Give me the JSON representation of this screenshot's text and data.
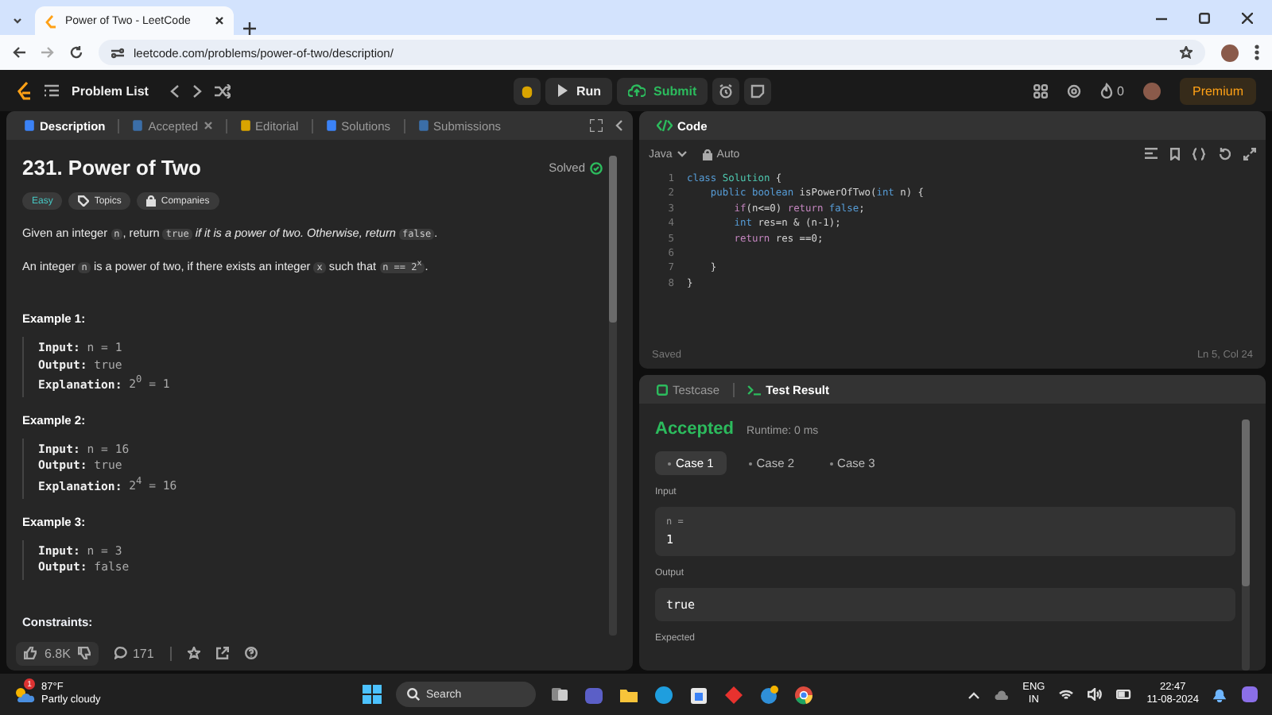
{
  "browser": {
    "tab_title": "Power of Two - LeetCode",
    "url": "leetcode.com/problems/power-of-two/description/"
  },
  "nav": {
    "problem_list": "Problem List",
    "run": "Run",
    "submit": "Submit",
    "streak": "0",
    "premium": "Premium"
  },
  "left_tabs": [
    {
      "label": "Description",
      "selected": true,
      "closable": false
    },
    {
      "label": "Accepted",
      "selected": false,
      "closable": true
    },
    {
      "label": "Editorial",
      "selected": false,
      "closable": false
    },
    {
      "label": "Solutions",
      "selected": false,
      "closable": false
    },
    {
      "label": "Submissions",
      "selected": false,
      "closable": false
    }
  ],
  "problem": {
    "title": "231. Power of Two",
    "status": "Solved",
    "difficulty": "Easy",
    "tags": [
      "Topics",
      "Companies"
    ],
    "paragraphs": [
      [
        {
          "kind": "text",
          "text": "Given an integer "
        },
        {
          "kind": "code",
          "text": "n"
        },
        {
          "kind": "text",
          "text": ", return "
        },
        {
          "kind": "code",
          "text": "true"
        },
        {
          "kind": "em",
          "text": " if it is a power of two. Otherwise, return "
        },
        {
          "kind": "code",
          "text": "false"
        },
        {
          "kind": "text",
          "text": "."
        }
      ],
      [
        {
          "kind": "text",
          "text": "An integer "
        },
        {
          "kind": "code",
          "text": "n"
        },
        {
          "kind": "text",
          "text": " is a power of two, if there exists an integer "
        },
        {
          "kind": "code",
          "text": "x"
        },
        {
          "kind": "text",
          "text": " such that "
        },
        {
          "kind": "code",
          "text": "n == 2$^{x}$"
        },
        {
          "kind": "text",
          "text": "."
        }
      ]
    ],
    "examples": [
      {
        "title": "Example 1:",
        "lines": [
          {
            "label": "Input:",
            "value": "n = 1"
          },
          {
            "label": "Output:",
            "value": "true"
          },
          {
            "label": "Explanation:",
            "value": "2$^{0}$ = 1"
          }
        ]
      },
      {
        "title": "Example 2:",
        "lines": [
          {
            "label": "Input:",
            "value": "n = 16"
          },
          {
            "label": "Output:",
            "value": "true"
          },
          {
            "label": "Explanation:",
            "value": "2$^{4}$ = 16"
          }
        ]
      },
      {
        "title": "Example 3:",
        "lines": [
          {
            "label": "Input:",
            "value": "n = 3"
          },
          {
            "label": "Output:",
            "value": "false"
          }
        ]
      }
    ],
    "constraints_heading": "Constraints:",
    "likes": "6.8K",
    "comments": "171"
  },
  "code": {
    "title": "Code",
    "language": "Java",
    "mode": "Auto",
    "status": "Saved",
    "cursor": "Ln 5, Col 24",
    "lines": [
      {
        "number": "1",
        "tokens": [
          {
            "kind": "kw",
            "text": "class"
          },
          {
            "kind": "type",
            "text": " Solution"
          },
          {
            "kind": "plain",
            "text": " {"
          }
        ]
      },
      {
        "number": "2",
        "tokens": [
          {
            "kind": "kw",
            "text": "    public boolean"
          },
          {
            "kind": "plain",
            "text": " isPowerOfTwo("
          },
          {
            "kind": "kw",
            "text": "int"
          },
          {
            "kind": "plain",
            "text": " n) {"
          }
        ]
      },
      {
        "number": "3",
        "tokens": [
          {
            "kind": "ctrl",
            "text": "        if"
          },
          {
            "kind": "plain",
            "text": "(n<=0) "
          },
          {
            "kind": "ctrl",
            "text": "return"
          },
          {
            "kind": "kw",
            "text": " false"
          },
          {
            "kind": "plain",
            "text": ";"
          }
        ]
      },
      {
        "number": "4",
        "tokens": [
          {
            "kind": "kw",
            "text": "        int"
          },
          {
            "kind": "plain",
            "text": " res=n & (n-1);"
          }
        ]
      },
      {
        "number": "5",
        "tokens": [
          {
            "kind": "ctrl",
            "text": "        return"
          },
          {
            "kind": "plain",
            "text": " res ==0;"
          }
        ]
      },
      {
        "number": "6"
      },
      {
        "number": "7",
        "tokens": [
          {
            "kind": "plain",
            "text": "    }"
          }
        ]
      },
      {
        "number": "8",
        "tokens": [
          {
            "kind": "plain",
            "text": "}"
          }
        ]
      }
    ]
  },
  "result_tabs": [
    {
      "label": "Testcase",
      "selected": false
    },
    {
      "label": "Test Result",
      "selected": true
    }
  ],
  "result": {
    "verdict": "Accepted",
    "runtime": "Runtime: 0 ms",
    "cases": [
      {
        "label": "Case 1",
        "selected": true
      },
      {
        "label": "Case 2",
        "selected": false
      },
      {
        "label": "Case 3",
        "selected": false
      }
    ],
    "sections": [
      {
        "kind": "input",
        "label": "Input",
        "name": "n =",
        "value": "1"
      },
      {
        "kind": "value",
        "label": "Output",
        "value": "true"
      },
      {
        "kind": "heading",
        "label": "Expected"
      }
    ]
  },
  "taskbar": {
    "temperature": "87°F",
    "condition": "Partly cloudy",
    "weather_badge": "1",
    "search_placeholder": "Search",
    "language": "ENG",
    "region": "IN",
    "time": "22:47",
    "date": "11-08-2024"
  }
}
